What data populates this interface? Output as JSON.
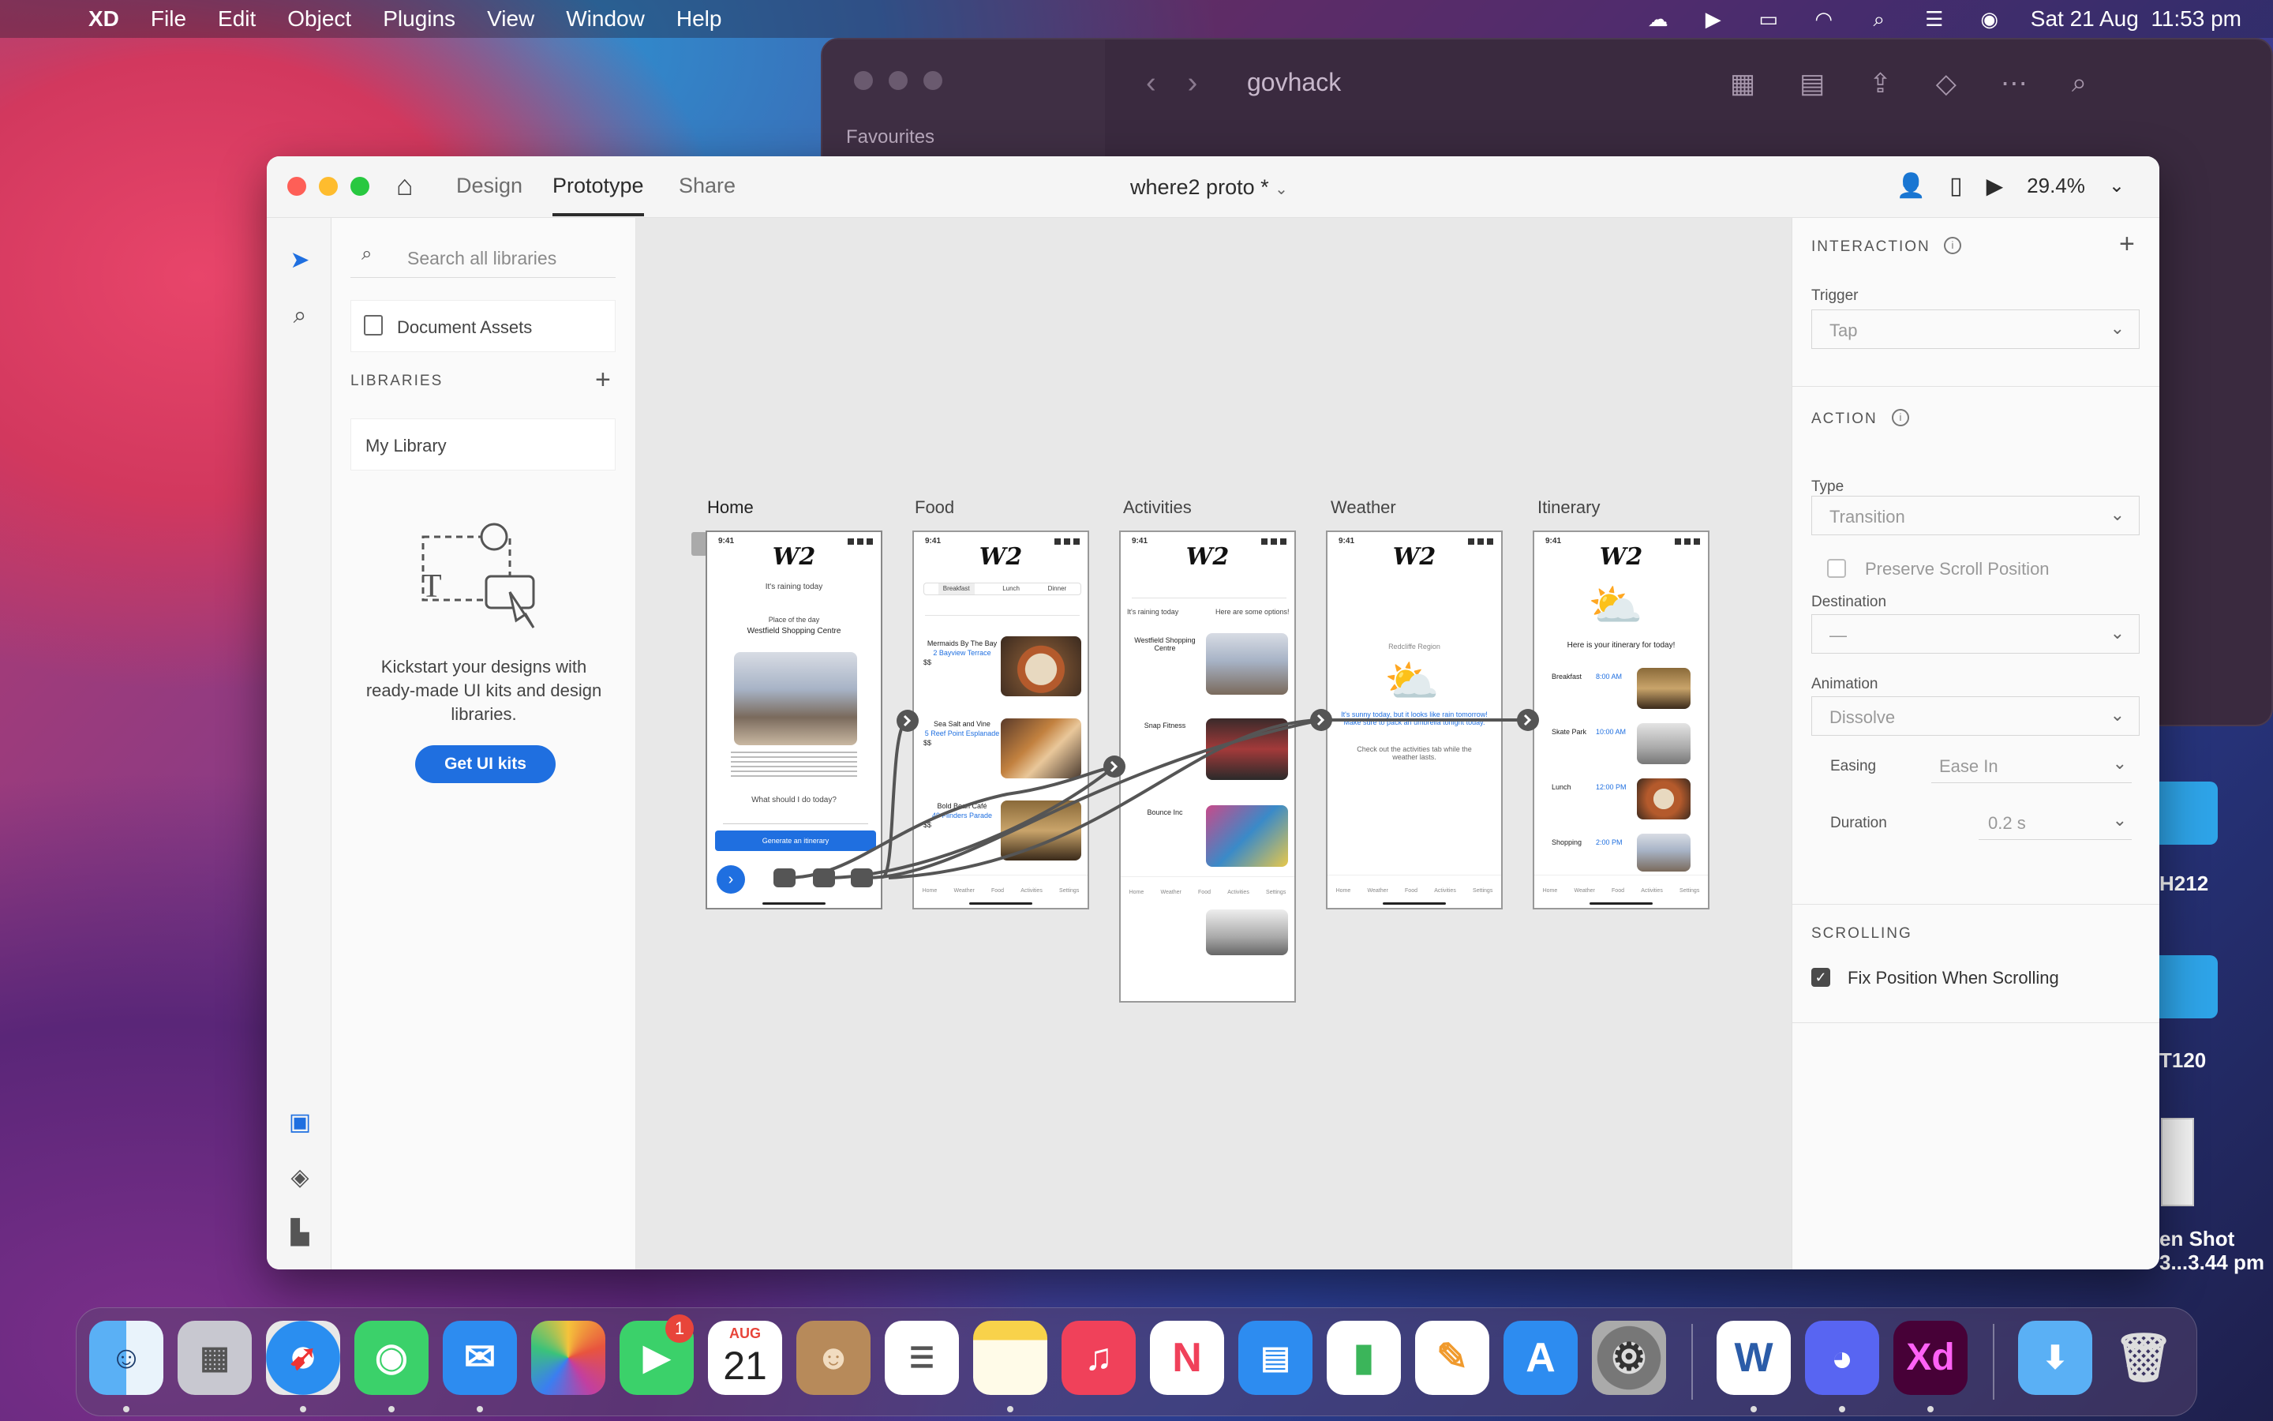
{
  "menubar": {
    "app": "XD",
    "menus": [
      "File",
      "Edit",
      "Object",
      "Plugins",
      "View",
      "Window",
      "Help"
    ],
    "datetime": "Sat 21 Aug  11:53 pm",
    "status_icons": [
      "creative-cloud-icon",
      "play-circle-icon",
      "battery-icon",
      "wifi-icon",
      "search-icon",
      "control-center-icon",
      "siri-icon"
    ]
  },
  "finder": {
    "title": "govhack",
    "sidebar_heading": "Favourites"
  },
  "desktop": {
    "labels": [
      "H212",
      "T120",
      "en Shot",
      "3...3.44 pm"
    ]
  },
  "xd": {
    "tabs": [
      "Design",
      "Prototype",
      "Share"
    ],
    "active_tab": "Prototype",
    "doc_title": "where2 proto *",
    "zoom": "29.4%",
    "libraries": {
      "search_placeholder": "Search all libraries",
      "document_assets": "Document Assets",
      "libraries_heading": "LIBRARIES",
      "my_library": "My Library",
      "kickstart_text": "Kickstart your designs with ready-made UI kits and design libraries.",
      "get_ui_kits": "Get UI kits"
    },
    "artboards": {
      "labels": [
        "Home",
        "Food",
        "Activities",
        "Weather",
        "Itinerary"
      ],
      "time": "9:41",
      "logo": "W2",
      "home": {
        "raining": "It's raining today",
        "place_of_day": "Place of the day",
        "place_name": "Westfield Shopping Centre",
        "what_should": "What should I do today?",
        "generate": "Generate an itinerary"
      },
      "food": {
        "tabs": [
          "Breakfast",
          "Lunch",
          "Dinner"
        ],
        "items": [
          "Mermaids By The Bay",
          "Sea Salt and Vine",
          "Bold Bean Café"
        ],
        "addresses": [
          "2 Bayview Terrace",
          "5 Reef Point Esplanade",
          "49 Flinders Parade"
        ],
        "price": "$$"
      },
      "activities": {
        "raining": "It's raining today",
        "options": "Here are some options!",
        "items": [
          "Westfield Shopping Centre",
          "Snap Fitness",
          "Bounce Inc"
        ]
      },
      "weather": {
        "region": "Redcliffe Region",
        "message": "It's sunny today, but it looks like rain tomorrow! Make sure to pack an umbrella tonight today.",
        "check": "Check out the activities tab while the weather lasts."
      },
      "itinerary": {
        "heading": "Here is your itinerary for today!",
        "entries": [
          {
            "label": "Breakfast",
            "time": "8:00 AM"
          },
          {
            "label": "Skate Park",
            "time": "10:00 AM"
          },
          {
            "label": "Lunch",
            "time": "12:00 PM"
          },
          {
            "label": "Shopping",
            "time": "2:00 PM"
          }
        ]
      },
      "tabbar": [
        "Home",
        "Weather",
        "Food",
        "Activities",
        "Settings"
      ]
    },
    "inspector": {
      "interaction_heading": "INTERACTION",
      "trigger_label": "Trigger",
      "trigger_value": "Tap",
      "action_heading": "ACTION",
      "type_label": "Type",
      "type_value": "Transition",
      "preserve_scroll": "Preserve Scroll Position",
      "destination_label": "Destination",
      "destination_value": "—",
      "animation_label": "Animation",
      "animation_value": "Dissolve",
      "easing_label": "Easing",
      "easing_value": "Ease In",
      "duration_label": "Duration",
      "duration_value": "0.2 s",
      "scrolling_heading": "SCROLLING",
      "fix_position": "Fix Position When Scrolling",
      "fix_position_checked": true
    }
  },
  "dock": {
    "apps": [
      "Finder",
      "Launchpad",
      "Safari",
      "Messages",
      "Mail",
      "Photos",
      "FaceTime",
      "Calendar",
      "Contacts",
      "Reminders",
      "Notes",
      "Music",
      "News",
      "Keynote",
      "Numbers",
      "Pages",
      "App Store",
      "System Preferences",
      "Word",
      "Discord",
      "Adobe XD",
      "Downloads",
      "Trash"
    ],
    "calendar_month": "AUG",
    "calendar_day": "21",
    "facetime_badge": "1",
    "xd_glyph": "Xd"
  }
}
